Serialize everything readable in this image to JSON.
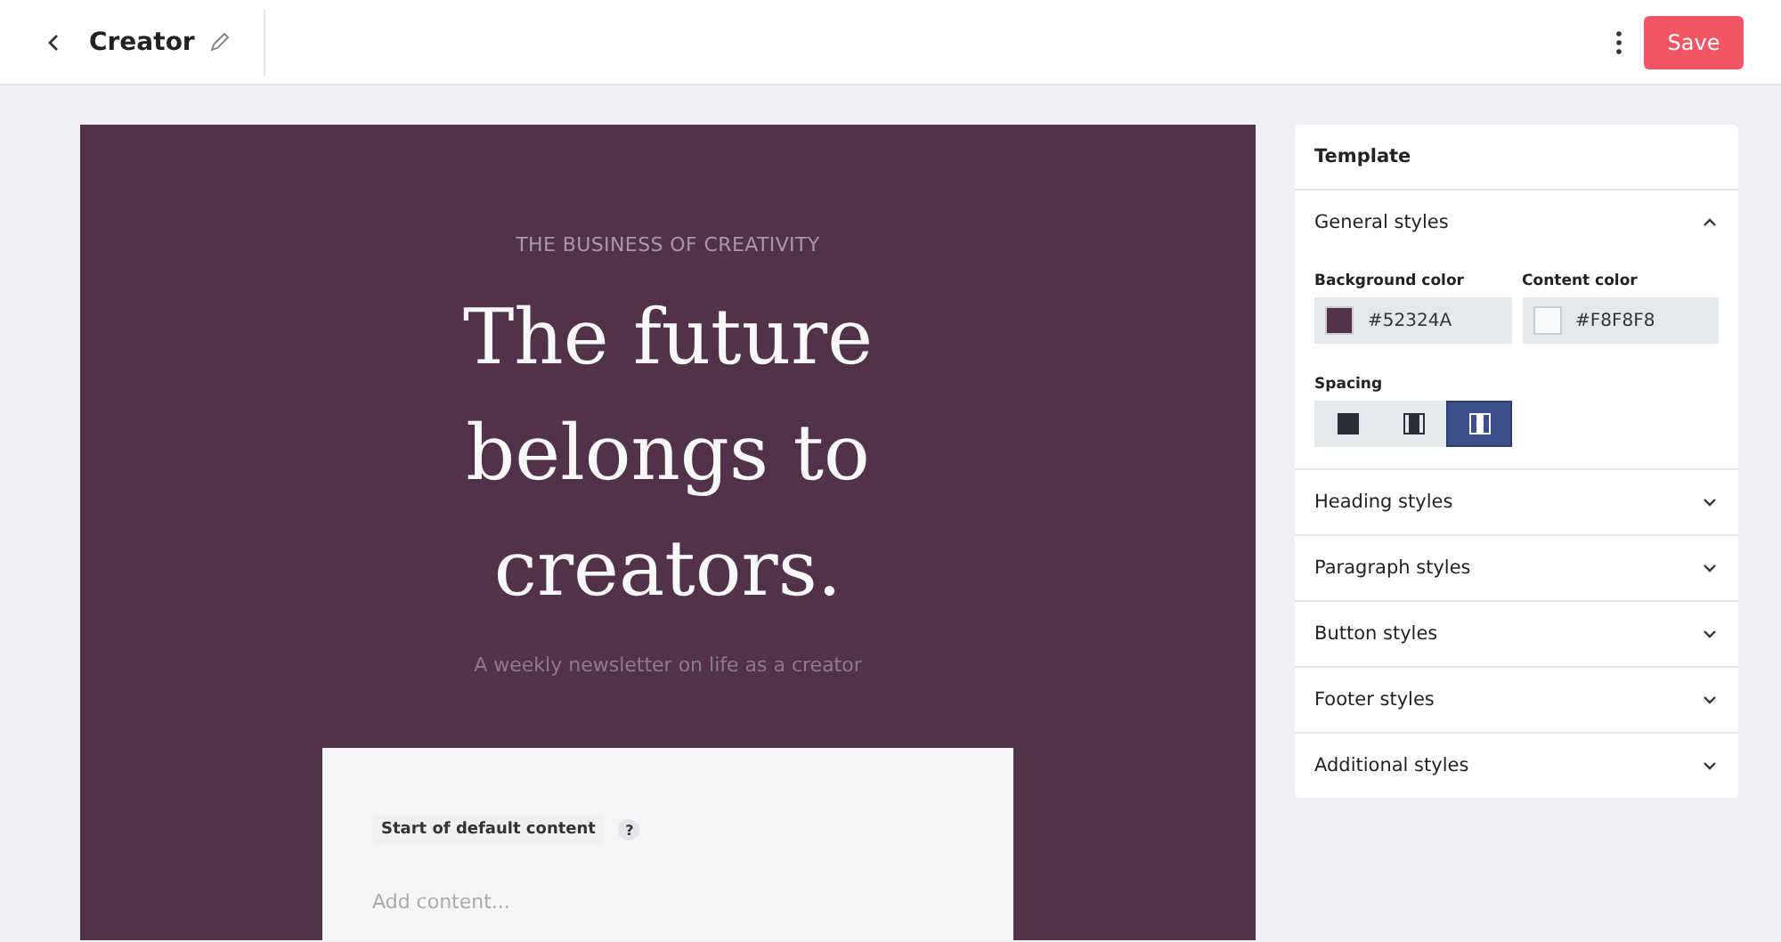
{
  "header": {
    "title": "Creator",
    "save": "Save"
  },
  "preview": {
    "eyebrow": "THE BUSINESS OF CREATIVITY",
    "headline": "The future belongs to creators.",
    "subtitle": "A weekly newsletter on life as a creator",
    "content_label": "Start of default content",
    "help": "?",
    "content_placeholder": "Add content..."
  },
  "panel": {
    "title": "Template",
    "sections": [
      {
        "title": "General styles",
        "expanded": true
      },
      {
        "title": "Heading styles",
        "expanded": false
      },
      {
        "title": "Paragraph styles",
        "expanded": false
      },
      {
        "title": "Button styles",
        "expanded": false
      },
      {
        "title": "Footer styles",
        "expanded": false
      },
      {
        "title": "Additional styles",
        "expanded": false
      }
    ],
    "colors": [
      {
        "label": "Background color",
        "value": "#52324A",
        "color": "#52324a"
      },
      {
        "label": "Content color",
        "value": "#F8F8F8",
        "color": "#f8f8f8"
      }
    ],
    "spacing_label": "Spacing",
    "spacing": [
      {
        "kind": "none",
        "selected": false
      },
      {
        "kind": "narrow",
        "selected": false
      },
      {
        "kind": "wide",
        "selected": true
      }
    ]
  }
}
